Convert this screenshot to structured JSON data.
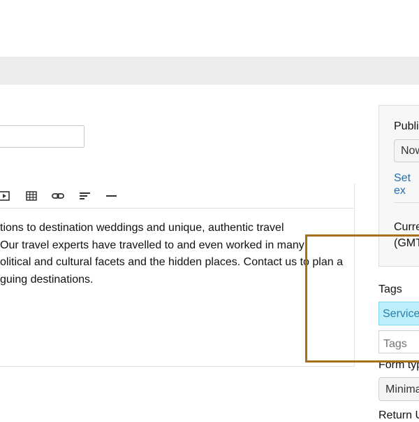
{
  "editor": {
    "toolbar": [
      "insert-media-icon",
      "table-icon",
      "link-icon",
      "align-icon",
      "horizontal-rule-icon"
    ],
    "lines": [
      "tions to destination weddings and unique, authentic travel",
      " Our travel experts have travelled to and even worked in many",
      "olitical and cultural facets and the hidden places. Contact us to plan a",
      "guing destinations."
    ]
  },
  "sidebar": {
    "publish_label": "Publi",
    "publish_select": "Now",
    "set_link": "Set ex",
    "current_line1": "Curre",
    "current_line2": "(GMT",
    "tags_label": "Tags",
    "tag_chip": "Service",
    "tags_placeholder": "Tags",
    "form_type_label": "Form typ",
    "form_type_value": "Minima",
    "return_label": "Return U"
  },
  "colors": {
    "highlight": "#a9701a",
    "tag_chip_bg": "#bdeefc",
    "link": "#1e6fb5"
  }
}
